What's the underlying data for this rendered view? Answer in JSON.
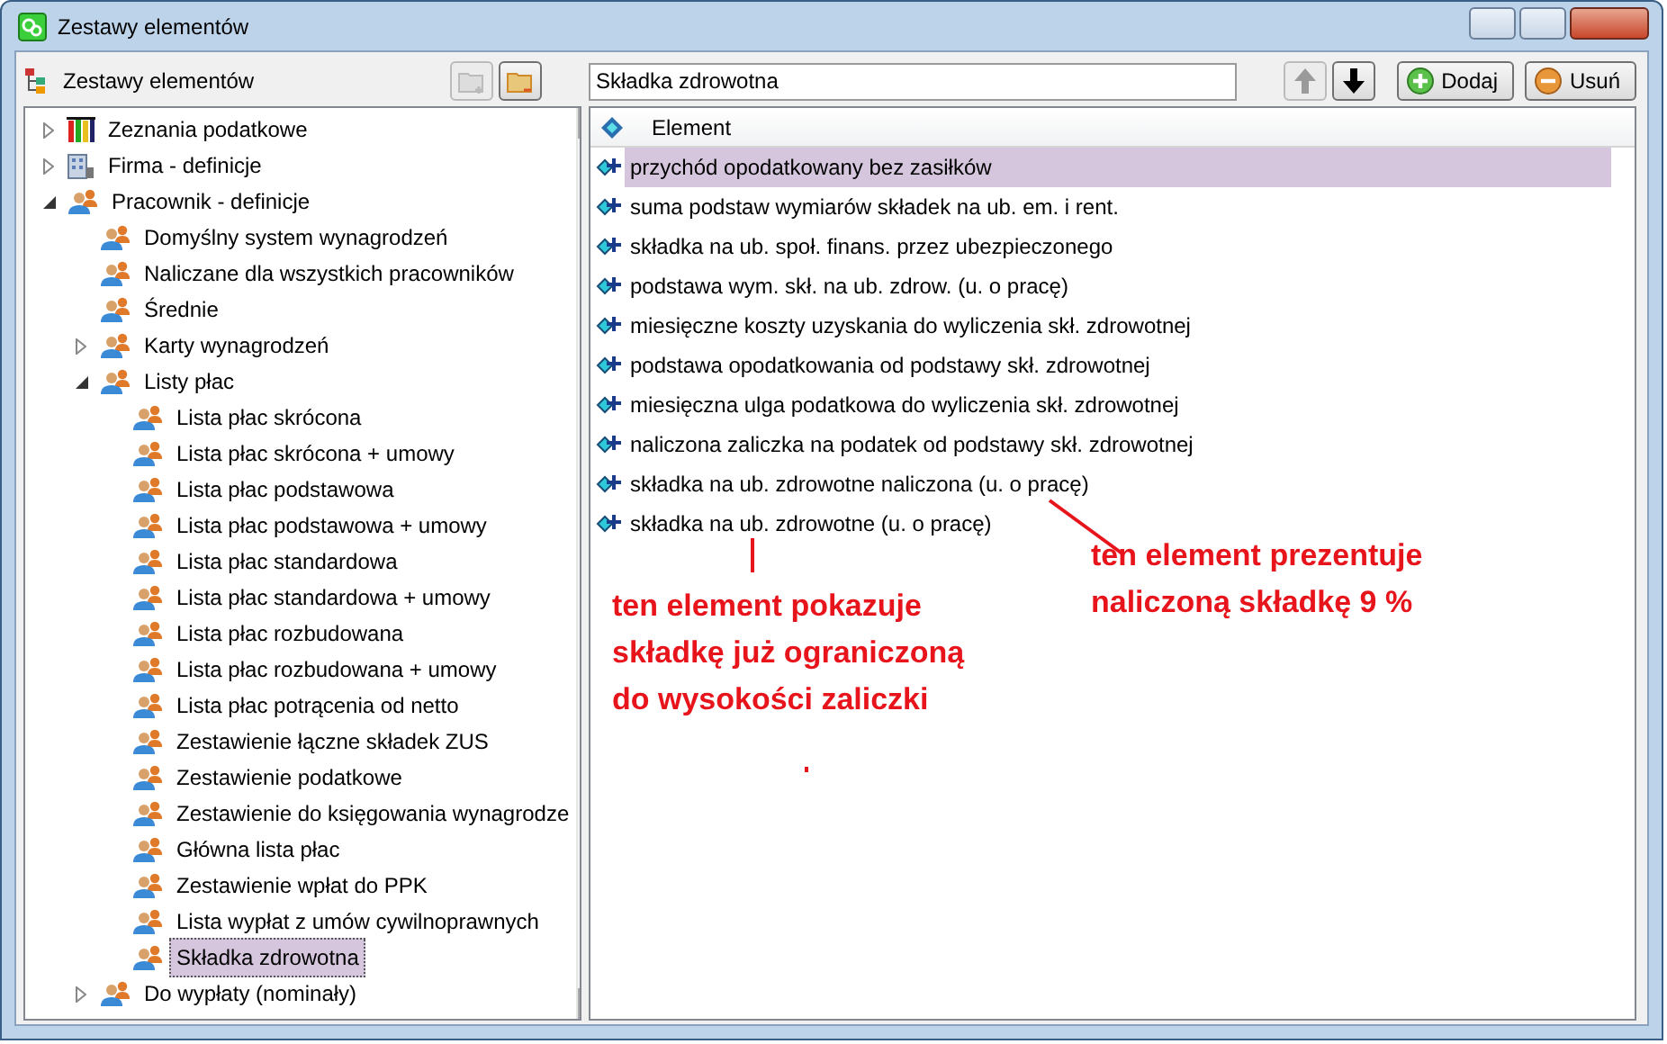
{
  "window": {
    "title": "Zestawy elementów"
  },
  "left_toolbar": {
    "label": "Zestawy elementów",
    "buttons": [
      {
        "kind": "add-folder",
        "disabled": true
      },
      {
        "kind": "remove-folder",
        "disabled": false
      }
    ]
  },
  "tree": [
    {
      "label": "Zeznania podatkowe",
      "kind": "books",
      "expanded": false,
      "selected": false
    },
    {
      "label": "Firma - definicje",
      "kind": "building",
      "expanded": false,
      "selected": false
    },
    {
      "label": "Pracownik - definicje",
      "kind": "people",
      "expanded": true,
      "selected": false,
      "children": [
        {
          "label": "Domyślny system wynagrodzeń",
          "kind": "people",
          "selected": false
        },
        {
          "label": "Naliczane dla wszystkich pracowników",
          "kind": "people",
          "selected": false
        },
        {
          "label": "Średnie",
          "kind": "people",
          "selected": false
        },
        {
          "label": "Karty wynagrodzeń",
          "kind": "people",
          "expanded": false,
          "selected": false
        },
        {
          "label": "Listy płac",
          "kind": "people",
          "expanded": true,
          "selected": false,
          "children": [
            {
              "label": "Lista płac skrócona",
              "kind": "people",
              "selected": false
            },
            {
              "label": "Lista płac skrócona + umowy",
              "kind": "people",
              "selected": false
            },
            {
              "label": "Lista płac podstawowa",
              "kind": "people",
              "selected": false
            },
            {
              "label": "Lista płac podstawowa + umowy",
              "kind": "people",
              "selected": false
            },
            {
              "label": "Lista płac standardowa",
              "kind": "people",
              "selected": false
            },
            {
              "label": "Lista płac standardowa + umowy",
              "kind": "people",
              "selected": false
            },
            {
              "label": "Lista płac rozbudowana",
              "kind": "people",
              "selected": false
            },
            {
              "label": "Lista płac rozbudowana + umowy",
              "kind": "people",
              "selected": false
            },
            {
              "label": "Lista płac potrącenia od netto",
              "kind": "people",
              "selected": false
            },
            {
              "label": "Zestawienie łączne składek ZUS",
              "kind": "people",
              "selected": false
            },
            {
              "label": "Zestawienie podatkowe",
              "kind": "people",
              "selected": false
            },
            {
              "label": "Zestawienie do księgowania wynagrodze",
              "kind": "people",
              "selected": false
            },
            {
              "label": "Główna lista płac",
              "kind": "people",
              "selected": false
            },
            {
              "label": "Zestawienie wpłat do PPK",
              "kind": "people",
              "selected": false
            },
            {
              "label": "Lista wypłat z umów cywilnoprawnych",
              "kind": "people",
              "selected": false
            },
            {
              "label": "Składka zdrowotna",
              "kind": "people",
              "selected": true
            }
          ]
        },
        {
          "label": "Do wypłaty (nominały)",
          "kind": "people",
          "expanded": false,
          "selected": false
        }
      ]
    }
  ],
  "name_field": {
    "value": "Składka zdrowotna"
  },
  "move_buttons": [
    {
      "kind": "up",
      "disabled": true
    },
    {
      "kind": "down",
      "disabled": false
    }
  ],
  "action_buttons": [
    {
      "label": "Dodaj",
      "kind": "add"
    },
    {
      "label": "Usuń",
      "kind": "remove"
    }
  ],
  "list": {
    "column": "Element",
    "rows": [
      {
        "text": "przychód opodatkowany bez zasiłków",
        "selected": true
      },
      {
        "text": "suma podstaw wymiarów składek na ub. em. i rent.",
        "selected": false
      },
      {
        "text": "składka na ub. społ. finans. przez ubezpieczonego",
        "selected": false
      },
      {
        "text": "podstawa wym. skł. na ub. zdrow. (u. o pracę)",
        "selected": false
      },
      {
        "text": "miesięczne koszty uzyskania do wyliczenia skł. zdrowotnej",
        "selected": false
      },
      {
        "text": "podstawa opodatkowania od podstawy skł. zdrowotnej",
        "selected": false
      },
      {
        "text": "miesięczna ulga podatkowa do wyliczenia skł. zdrowotnej",
        "selected": false
      },
      {
        "text": "naliczona zaliczka na podatek od podstawy skł. zdrowotnej",
        "selected": false
      },
      {
        "text": "składka na ub. zdrowotne naliczona (u. o pracę)",
        "selected": false
      },
      {
        "text": "składka na ub. zdrowotne (u. o pracę)",
        "selected": false
      }
    ]
  },
  "annotations": [
    {
      "lines": [
        "ten element pokazuje",
        "składkę już ograniczoną",
        "do wysokości zaliczki"
      ]
    },
    {
      "lines": [
        "ten element prezentuje",
        "naliczoną składkę 9 %"
      ]
    }
  ]
}
